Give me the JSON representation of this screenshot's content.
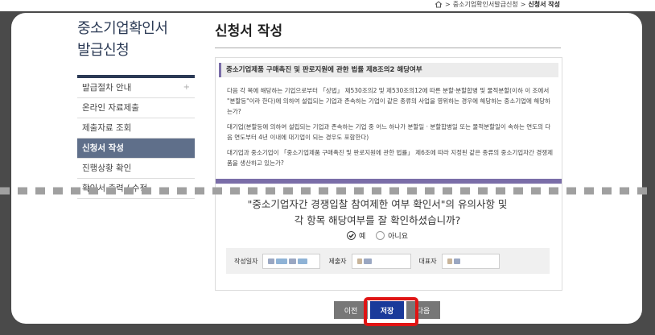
{
  "breadcrumb": {
    "sep": ">",
    "parent": "중소기업확인서발급신청",
    "current": "신청서 작성"
  },
  "sidebar": {
    "title_line1": "중소기업확인서",
    "title_line2": "발급신청",
    "items": [
      {
        "label": "발급절차 안내",
        "icon": "plus-icon"
      },
      {
        "label": "온라인 자료제출"
      },
      {
        "label": "제출자료 조회"
      },
      {
        "label": "신청서 작성"
      },
      {
        "label": "진행상황 확인"
      },
      {
        "label": "확인서 출력 / 수정"
      }
    ]
  },
  "main": {
    "title": "신청서 작성",
    "section_title": "중소기업제품 구매촉진 및 판로지원에 관한 법률 제8조의2 해당여부",
    "para1": "다음 각 목에 해당하는 기업으로부터 「상법」 제530조의2 및 제530조의12에 따른 분할·분할합병 및 물적분할(이하 이 조에서 \"분할등\"이라 한다)에 의하여 설립되는 기업과 존속하는 기업이 같은 종류의 사업을 영위하는 경우에 해당하는 중소기업에 해당하는가?",
    "para2": "대기업(분할등에 의하여 설립되는 기업과 존속하는 기업 중 어느 하나가 분할일 · 분할합병일 또는 물적분할일이 속하는 연도의 다음 연도부터 4년 이내에 대기업이 되는 경우도 포함한다)",
    "para3": "대기업과 중소기업이 「중소기업제품 구매촉진 및 판로지원에 관한 법률」 제6조에 따라 지정된 같은 종류의 중소기업자간 경쟁제품을 생산하고 있는가?"
  },
  "confirm": {
    "line1": "\"중소기업자간 경쟁입찰 참여제한 여부 확인서\"의 유의사항 및",
    "line2": "각 항목 해당여부를 잘 확인하셨습니까?",
    "yes": "예",
    "no": "아니요",
    "selected": "yes"
  },
  "info": {
    "date_label": "작성일자",
    "submitter_label": "제출자",
    "ceo_label": "대표자"
  },
  "buttons": {
    "prev": "이전",
    "save": "저장",
    "next": "다음"
  },
  "colors": {
    "accent": "#7a6da8",
    "nav_active": "#5f6f8a",
    "save_button": "#1a3a9a",
    "highlight": "#e01414"
  }
}
